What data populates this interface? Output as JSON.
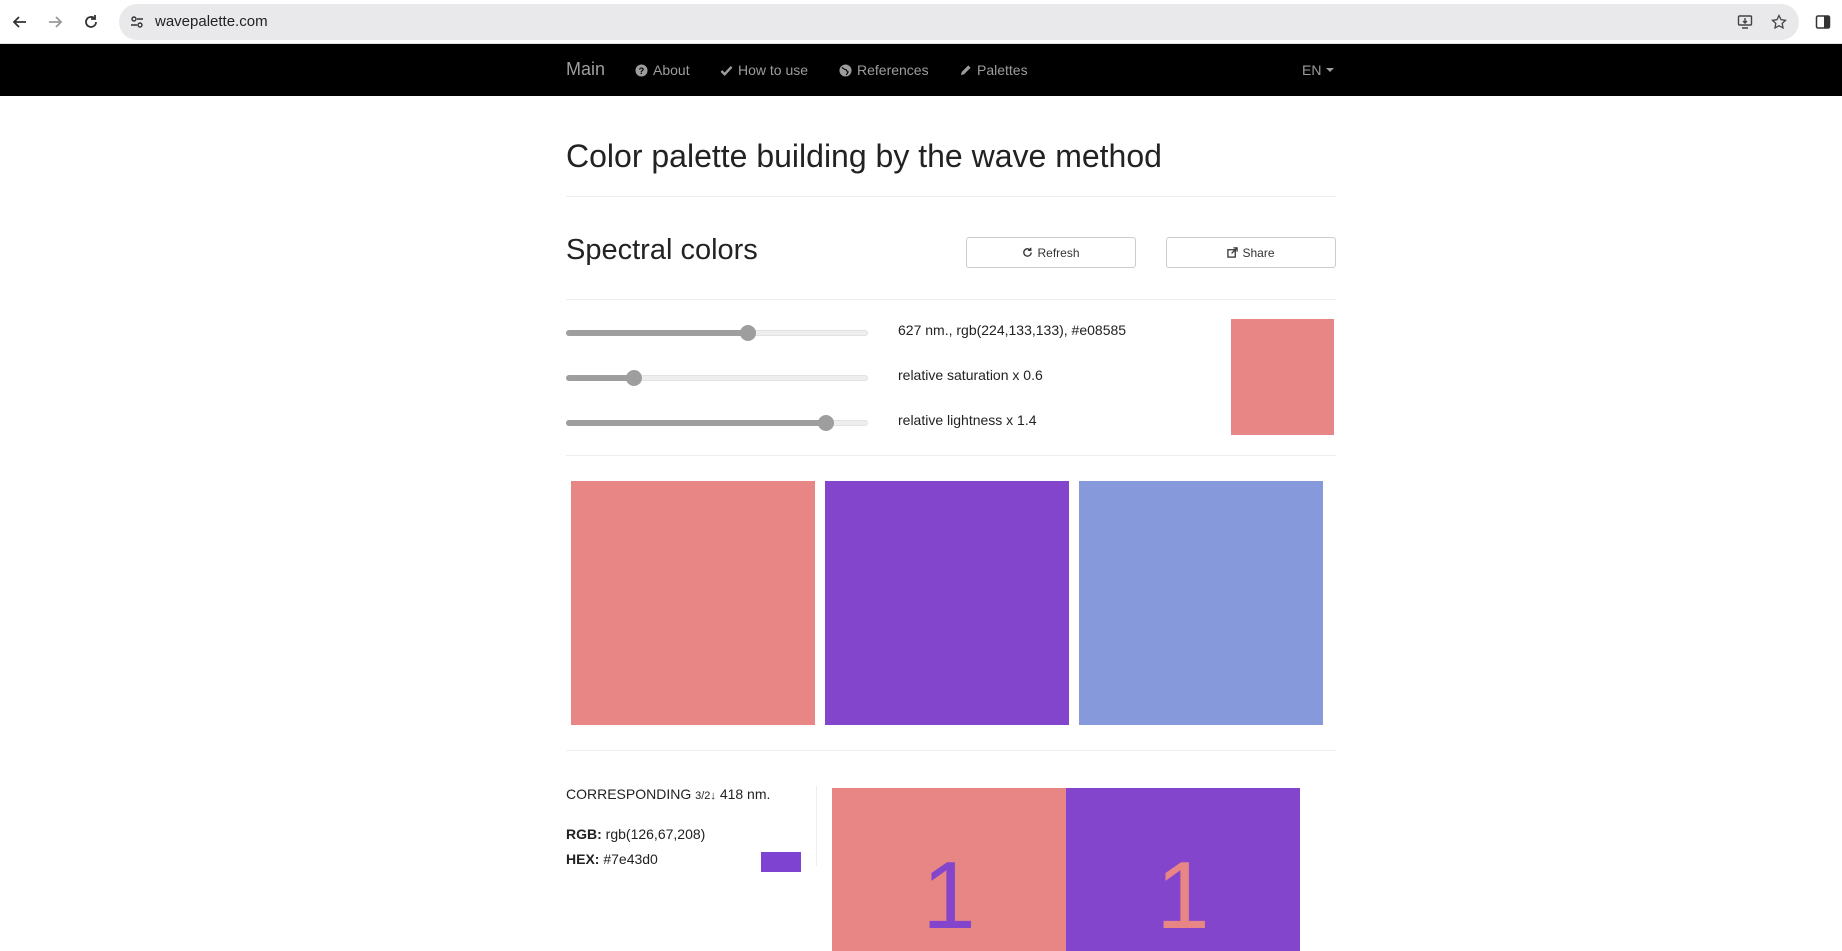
{
  "browser": {
    "url": "wavepalette.com"
  },
  "navbar": {
    "brand": "Main",
    "items": [
      {
        "label": "About",
        "icon": "question-circle-icon"
      },
      {
        "label": "How to use",
        "icon": "check-icon"
      },
      {
        "label": "References",
        "icon": "globe-icon"
      },
      {
        "label": "Palettes",
        "icon": "pencil-icon"
      }
    ],
    "language": "EN"
  },
  "page": {
    "title": "Color palette building by the wave method",
    "section_title": "Spectral colors",
    "refresh_label": "Refresh",
    "share_label": "Share"
  },
  "sliders": [
    {
      "name": "wavelength",
      "label": "627 nm., rgb(224,133,133), #e08585",
      "value_fraction": 0.61
    },
    {
      "name": "saturation",
      "label": "relative saturation x 0.6",
      "value_fraction": 0.21
    },
    {
      "name": "lightness",
      "label": "relative lightness x 1.4",
      "value_fraction": 0.88
    }
  ],
  "preview_color": "#e88585",
  "palette": [
    "#e88585",
    "#8345cc",
    "#8699db"
  ],
  "corresponding": {
    "heading": "CORRESPONDING",
    "ratio": "3/2↓",
    "wavelength": "418 nm.",
    "rgb_label": "RGB:",
    "rgb_value": "rgb(126,67,208)",
    "hex_label": "HEX:",
    "hex_value": "#7e43d0",
    "swatch_color": "#7e43d0"
  },
  "pairs": [
    {
      "digit": "1",
      "bg": "#e88585",
      "fg": "#8345cc"
    },
    {
      "digit": "1",
      "bg": "#8345cc",
      "fg": "#e88585"
    }
  ]
}
